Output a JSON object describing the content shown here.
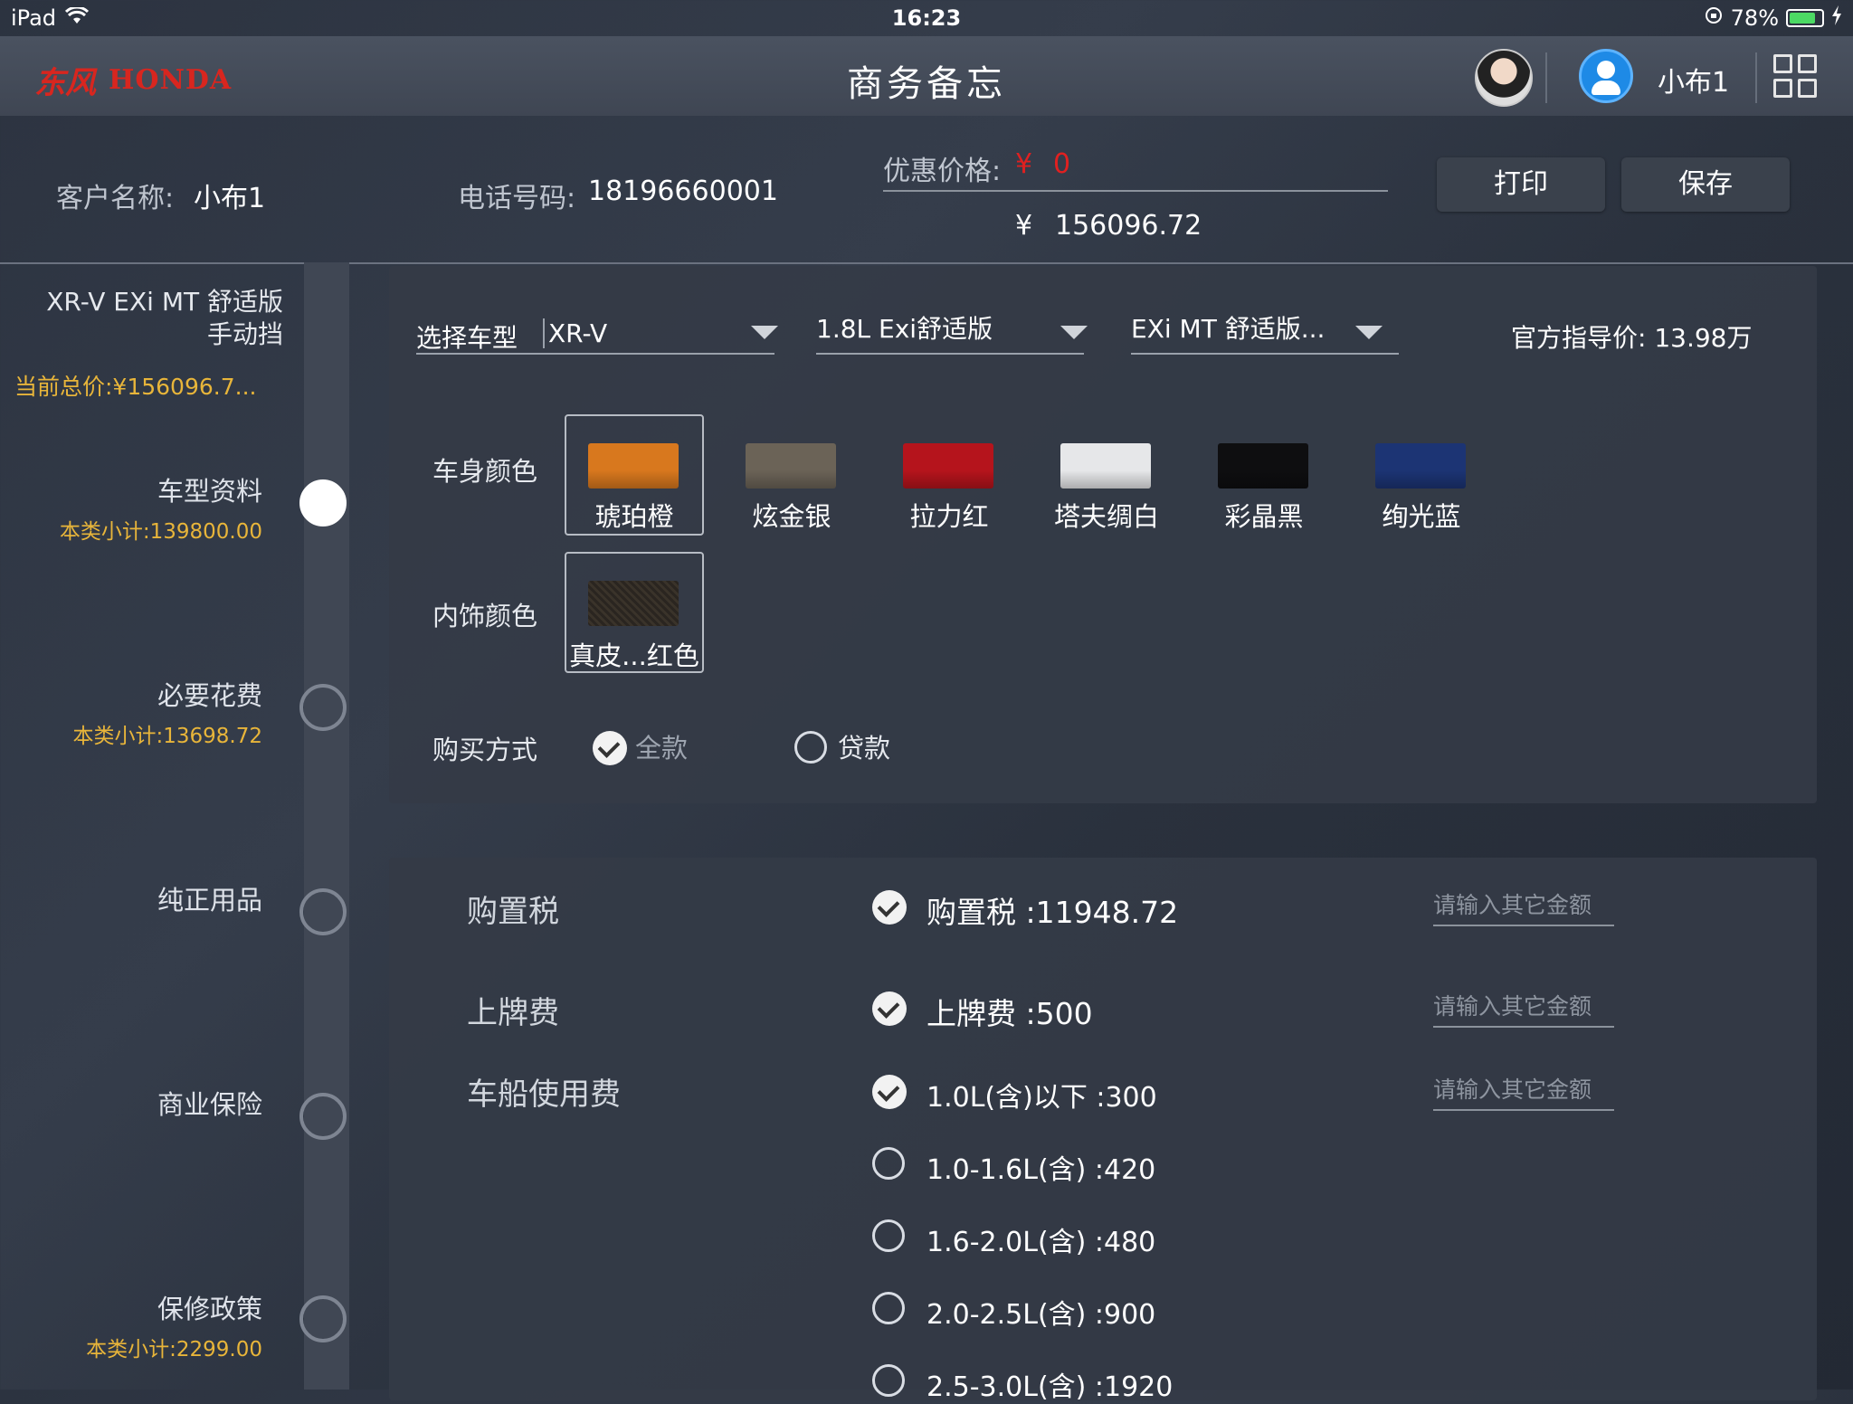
{
  "status_bar": {
    "device": "iPad",
    "time": "16:23",
    "battery": "78%"
  },
  "header": {
    "logo_cn": "东风",
    "logo_en": "HONDA",
    "title": "商务备忘",
    "user_name": "小布1"
  },
  "info": {
    "customer_label": "客户名称:",
    "customer_value": "小布1",
    "phone_label": "电话号码:",
    "phone_value": "18196660001",
    "discount_label": "优惠价格:",
    "discount_symbol": "¥",
    "discount_value": "0",
    "total_symbol": "¥",
    "total_value": "156096.72",
    "print_label": "打印",
    "save_label": "保存"
  },
  "sidebar": {
    "model_line1": "XR-V EXi MT 舒适版",
    "model_line2": "手动挡",
    "current_total": "当前总价:¥156096.7...",
    "steps": [
      {
        "label": "车型资料",
        "subtotal": "本类小计:139800.00"
      },
      {
        "label": "必要花费",
        "subtotal": "本类小计:13698.72"
      },
      {
        "label": "纯正用品",
        "subtotal": ""
      },
      {
        "label": "商业保险",
        "subtotal": ""
      },
      {
        "label": "保修政策",
        "subtotal": "本类小计:2299.00"
      }
    ]
  },
  "vehicle": {
    "select_label": "选择车型",
    "model_value": "XR-V",
    "engine_value": "1.8L Exi舒适版",
    "trim_value": "EXi MT  舒适版...",
    "guide_price": "官方指导价: 13.98万",
    "body_color_label": "车身颜色",
    "body_colors": [
      {
        "name": "琥珀橙",
        "hex": "#d8781e"
      },
      {
        "name": "炫金银",
        "hex": "#6b6357"
      },
      {
        "name": "拉力红",
        "hex": "#b5141c"
      },
      {
        "name": "塔夫绸白",
        "hex": "#e6e7e9"
      },
      {
        "name": "彩晶黑",
        "hex": "#0e0e10"
      },
      {
        "name": "绚光蓝",
        "hex": "#1c3474"
      }
    ],
    "interior_label": "内饰颜色",
    "interior_name": "真皮...红色",
    "purchase_label": "购买方式",
    "purchase_full": "全款",
    "purchase_loan": "贷款"
  },
  "fees": {
    "placeholder": "请输入其它金额",
    "purchase_tax_name": "购置税",
    "purchase_tax_item": "购置税  :11948.72",
    "plate_fee_name": "上牌费",
    "plate_fee_item": "上牌费  :500",
    "vessel_tax_name": "车船使用费",
    "vessel_options": [
      "1.0L(含)以下  :300",
      "1.0-1.6L(含)  :420",
      "1.6-2.0L(含)  :480",
      "2.0-2.5L(含) :900",
      "2.5-3.0L(含) :1920"
    ]
  }
}
